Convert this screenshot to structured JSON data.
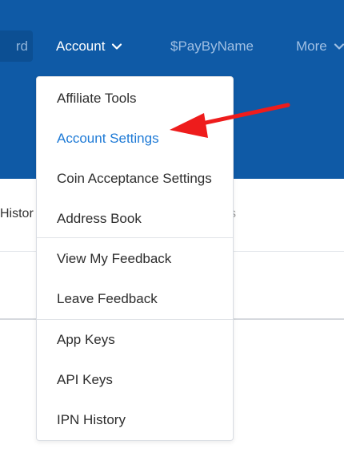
{
  "nav": {
    "dashboard_partial": "rd",
    "account_label": "Account",
    "paybyname_label": "$PayByName",
    "more_label": "More"
  },
  "content": {
    "tab_fragment": "Histor",
    "tab_fragment_right": "s"
  },
  "dropdown": {
    "items": [
      {
        "label": "Affiliate Tools"
      },
      {
        "label": "Account Settings",
        "active": true
      },
      {
        "label": "Coin Acceptance Settings"
      },
      {
        "label": "Address Book"
      },
      {
        "label": "View My Feedback"
      },
      {
        "label": "Leave Feedback"
      },
      {
        "label": "App Keys"
      },
      {
        "label": "API Keys"
      },
      {
        "label": "IPN History"
      }
    ]
  },
  "colors": {
    "header_bg": "#0f5aa6",
    "active_item": "#1e7ad6",
    "annotation_arrow": "#ee1c1c"
  }
}
